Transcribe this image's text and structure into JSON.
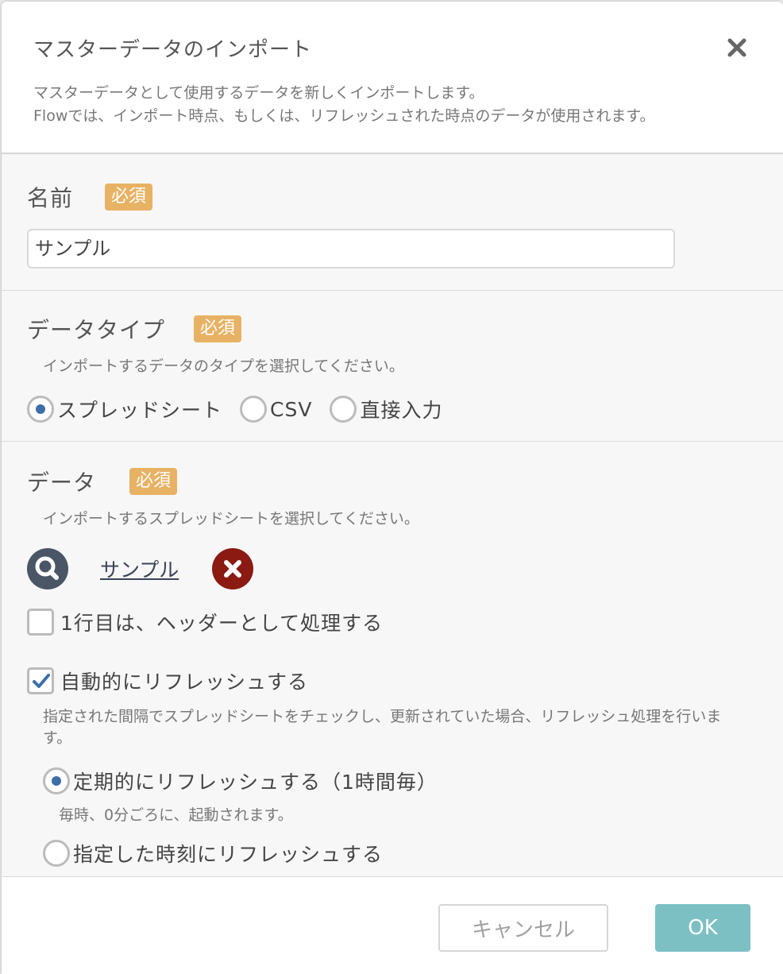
{
  "dialog": {
    "title": "マスターデータのインポート",
    "description_line1": "マスターデータとして使用するデータを新しくインポートします。",
    "description_line2": "Flowでは、インポート時点、もしくは、リフレッシュされた時点のデータが使用されます。"
  },
  "required_label": "必須",
  "name_field": {
    "label": "名前",
    "value": "サンプル"
  },
  "data_type": {
    "label": "データタイプ",
    "hint": "インポートするデータのタイプを選択してください。",
    "options": [
      "スプレッドシート",
      "CSV",
      "直接入力"
    ],
    "selected": "スプレッドシート"
  },
  "data": {
    "label": "データ",
    "hint": "インポートするスプレッドシートを選択してください。",
    "file_name": "サンプル",
    "header_checkbox_label": "1行目は、ヘッダーとして処理する",
    "header_checked": false,
    "auto_refresh_label": "自動的にリフレッシュする",
    "auto_refresh_checked": true,
    "auto_refresh_hint": "指定された間隔でスプレッドシートをチェックし、更新されていた場合、リフレッシュ処理を行います。",
    "refresh_options": {
      "periodic_label": "定期的にリフレッシュする（1時間毎）",
      "periodic_hint": "毎時、0分ごろに、起動されます。",
      "scheduled_label": "指定した時刻にリフレッシュする",
      "selected": "periodic"
    }
  },
  "footer": {
    "cancel_label": "キャンセル",
    "ok_label": "OK"
  },
  "colors": {
    "required_badge": "#e8b264",
    "radio_selected": "#3d6ea8",
    "ok_button": "#7cc0c4",
    "remove_button": "#8a1a12",
    "search_button": "#4a5565"
  }
}
